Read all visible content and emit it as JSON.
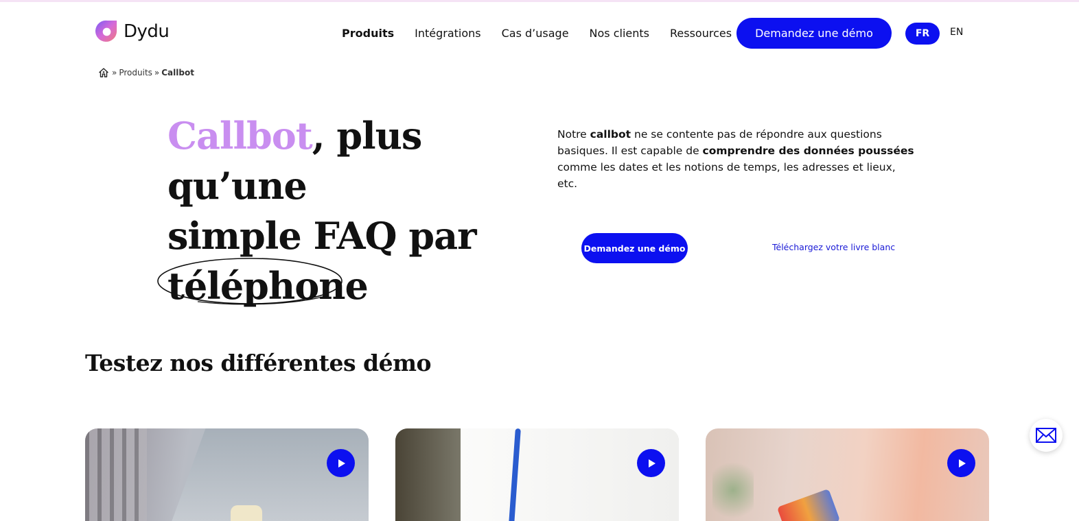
{
  "brand": {
    "name": "Dydu",
    "accent": "#0c10f0",
    "highlight": "#eef96a",
    "title_accent": "#c98ef0"
  },
  "nav": {
    "items": [
      {
        "label": "Produits",
        "active": true
      },
      {
        "label": "Intégrations"
      },
      {
        "label": "Cas d’usage"
      },
      {
        "label": "Nos clients"
      },
      {
        "label": "Ressources"
      }
    ],
    "cta": "Demandez une démo",
    "lang_fr": "FR",
    "lang_en": "EN"
  },
  "breadcrumb": {
    "sep1": "»",
    "produits": "Produits",
    "sep2": "»",
    "current": "Callbot"
  },
  "hero": {
    "title_accent": "Callbot",
    "title_rest_1": ", plus qu’une",
    "title_line2": "simple FAQ par",
    "title_circled": "téléphone",
    "desc": {
      "p1": "Notre ",
      "b1": "callbot",
      "p2": " ne se contente pas de répondre aux questions basiques. Il est capable de ",
      "b2": "comprendre des données poussées",
      "p3": " comme les dates et les notions de temps, les adresses et lieux, etc."
    },
    "cta_demo": "Demandez une démo",
    "cta_livre": "Téléchargez votre livre blanc"
  },
  "demos": {
    "title": "Testez nos différentes démo",
    "cards": [
      {
        "play_icon": "play-icon"
      },
      {
        "play_icon": "play-icon"
      },
      {
        "play_icon": "play-icon"
      }
    ]
  },
  "fab": {
    "icon": "mail-icon"
  }
}
